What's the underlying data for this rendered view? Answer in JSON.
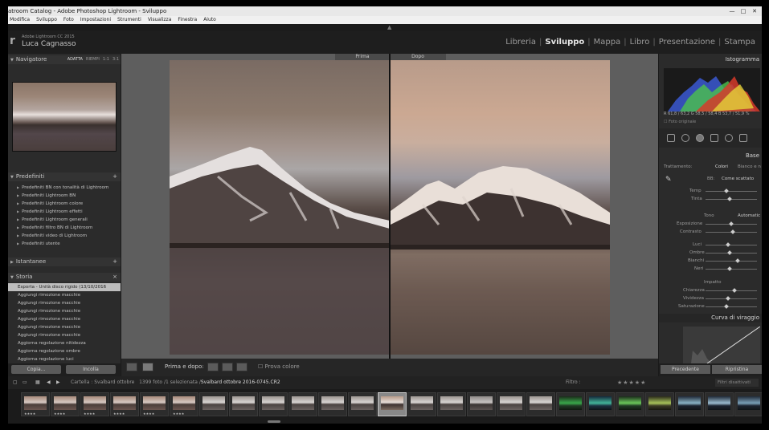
{
  "window": {
    "title": "atroom Catalog - Adobe Photoshop Lightroom - Sviluppo",
    "controls": [
      "minimize-icon",
      "maximize-icon",
      "close-icon"
    ]
  },
  "menu": [
    "Modifica",
    "Sviluppo",
    "Foto",
    "Impostazioni",
    "Strumenti",
    "Visualizza",
    "Finestra",
    "Aiuto"
  ],
  "identity": {
    "product": "Adobe Lightroom CC 2015",
    "name": "Luca Cagnasso"
  },
  "modules": [
    "Libreria",
    "Sviluppo",
    "Mappa",
    "Libro",
    "Presentazione",
    "Stampa"
  ],
  "active_module": "Sviluppo",
  "left_panel": {
    "navigator": {
      "title": "Navigatore",
      "options": [
        "ADATTA",
        "RIEMPI",
        "1:1",
        "3:1"
      ]
    },
    "presets": {
      "title": "Predefiniti",
      "items": [
        "Predefiniti BN con tonalità di Lightroom",
        "Predefiniti Lightroom BN",
        "Predefiniti Lightroom colore",
        "Predefiniti Lightroom effetti",
        "Predefiniti Lightroom generali",
        "Predefiniti filtro BN di Lightroom",
        "Predefiniti video di Lightroom",
        "Predefiniti utente"
      ]
    },
    "snapshots": {
      "title": "Istantanee"
    },
    "history": {
      "title": "Storia",
      "items": [
        "Esporta - Unità disco rigido (13/10/2016 17:1...",
        "Aggiungi rimozione macchie",
        "Aggiungi rimozione macchie",
        "Aggiungi rimozione macchie",
        "Aggiungi rimozione macchie",
        "Aggiungi rimozione macchie",
        "Aggiungi rimozione macchie",
        "Aggiorna regolazione nitidezza",
        "Aggiorna regolazione ombre",
        "Aggiorna regolazione luci"
      ]
    },
    "copy_button": "Copia...",
    "paste_button": "Incolla"
  },
  "center": {
    "before_label": "Prima",
    "after_label": "Dopo"
  },
  "toolbar": {
    "before_after_label": "Prima e dopo:",
    "proof_label": "Prova colore"
  },
  "right_panel": {
    "histogram_title": "Istogramma",
    "readout": "R  61,8 / 63,2  G  58,5 / 58,4  B  53,7 / 51,9  %",
    "original_photo": "Foto originale",
    "basic_title": "Base",
    "treatment_label": "Trattamento:",
    "treatment_color": "Colori",
    "treatment_bw": "Bianco e n",
    "wb_label": "BB:",
    "wb_value": "Come scattato",
    "temp_label": "Temp",
    "tint_label": "Tinta",
    "tone_label": "Tono",
    "auto_label": "Automatic",
    "exposure_label": "Esposizione",
    "contrast_label": "Contrasto",
    "highlights_label": "Luci",
    "shadows_label": "Ombre",
    "whites_label": "Bianchi",
    "blacks_label": "Neri",
    "presence_label": "Impatto",
    "clarity_label": "Chiarezza",
    "vibrance_label": "Vividezza",
    "saturation_label": "Saturazione",
    "tone_curve_title": "Curva di viraggio",
    "previous_button": "Precedente",
    "reset_button": "Ripristina"
  },
  "filmstrip": {
    "source_prefix": "Cartella : Svalbard ottobre",
    "count": "1399 foto /1 selezionata /",
    "file": "Svalbard ottobre 2016-0745.CR2",
    "filter_label": "Filtro :",
    "filter_value": "Filtri disattivati",
    "stars": "★★★★★"
  },
  "colors": {
    "accent": "#e6e6e6",
    "panel": "#2b2b2b",
    "background": "#1a1a1a"
  }
}
